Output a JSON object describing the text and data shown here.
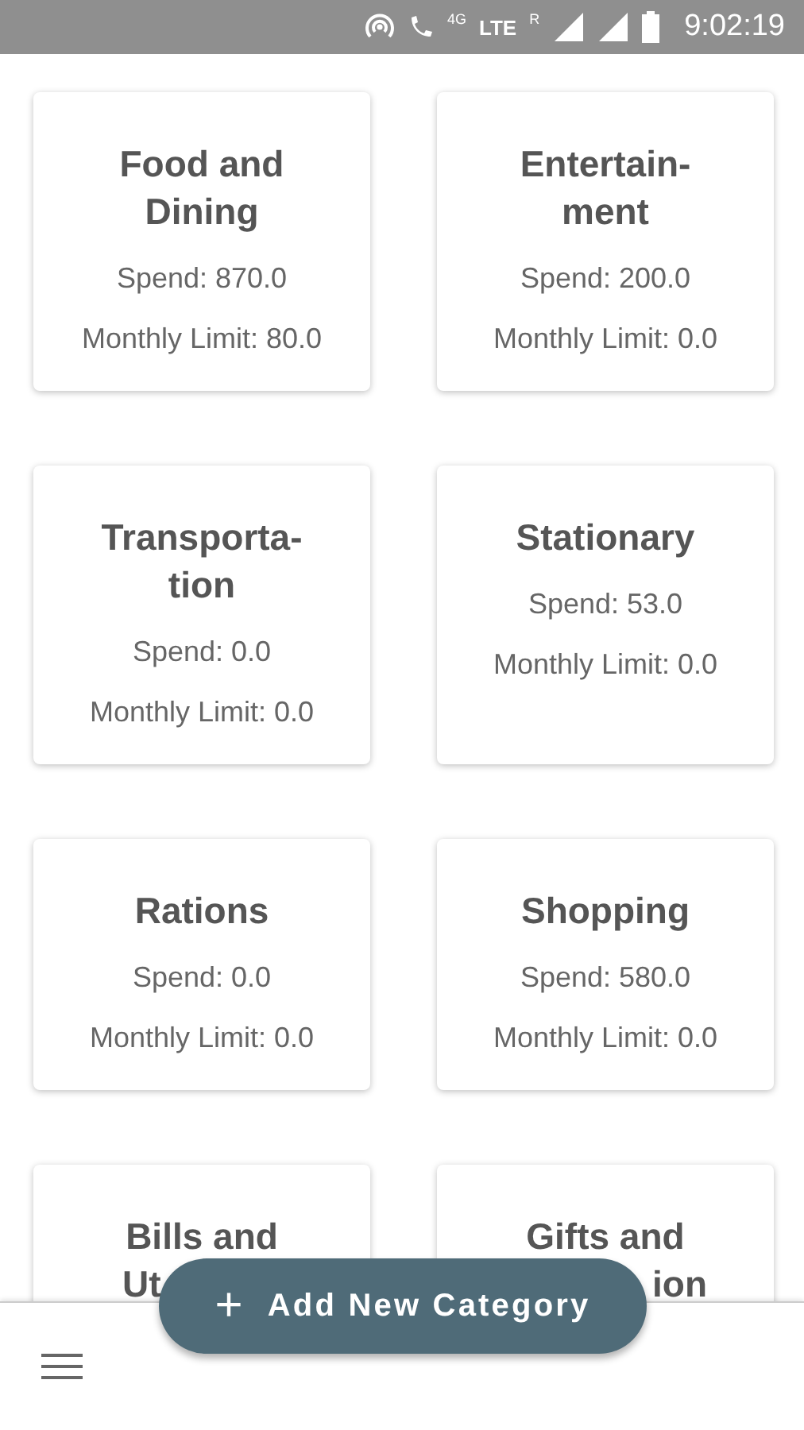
{
  "status_bar": {
    "network_badge": "4G",
    "network": "LTE",
    "roaming": "R",
    "time": "9:02:19"
  },
  "categories": [
    {
      "kind": "full",
      "title": "Food and Dining",
      "spend": "Spend: 870.0",
      "limit": "Monthly Limit: 80.0"
    },
    {
      "kind": "full",
      "title": "Entertain-ment",
      "spend": "Spend: 200.0",
      "limit": "Monthly Limit: 0.0"
    },
    {
      "kind": "full",
      "title": "Transporta-tion",
      "spend": "Spend: 0.0",
      "limit": "Monthly Limit: 0.0"
    },
    {
      "kind": "full",
      "title": "Stationary",
      "spend": "Spend: 53.0",
      "limit": "Monthly Limit: 0.0"
    },
    {
      "kind": "full",
      "title": "Rations",
      "spend": "Spend: 0.0",
      "limit": "Monthly Limit: 0.0"
    },
    {
      "kind": "full",
      "title": "Shopping",
      "spend": "Spend: 580.0",
      "limit": "Monthly Limit: 0.0"
    },
    {
      "kind": "covered",
      "title_lines": [
        "Bills and",
        "Ut"
      ]
    },
    {
      "kind": "covered",
      "title_lines": [
        "Gifts and",
        "ion"
      ]
    }
  ],
  "fab": {
    "icon": "+",
    "label": "Add New Category"
  }
}
